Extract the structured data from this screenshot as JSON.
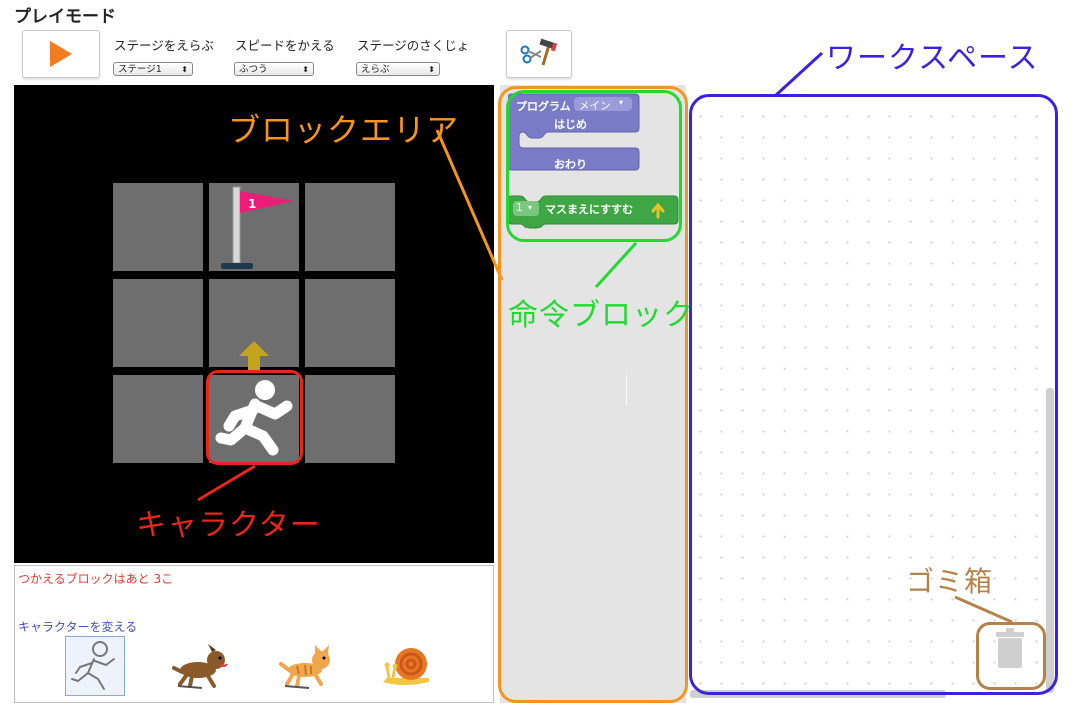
{
  "page_title": "プレイモード",
  "controls": {
    "stage_label": "ステージをえらぶ",
    "stage_value": "ステージ1",
    "speed_label": "スピードをかえる",
    "speed_value": "ふつう",
    "delete_label": "ステージのさくじょ",
    "delete_value": "えらぶ"
  },
  "blocks": {
    "program_label": "プログラム",
    "program_dropdown": "メイン",
    "start_label": "はじめ",
    "end_label": "おわり",
    "move_count": "1",
    "move_label": "マスまえにすすむ"
  },
  "info": {
    "blocks_left": "つかえるブロックはあと 3こ",
    "change_character": "キャラクターを変える"
  },
  "annotations": {
    "block_area": "ブロックエリア",
    "command_block": "命令ブロック",
    "workspace": "ワークスペース",
    "character": "キャラクター",
    "trash": "ゴミ箱"
  },
  "flag_number": "1",
  "icons": [
    "play-icon",
    "tools-icon",
    "flag-icon",
    "up-arrow-icon",
    "runner-icon",
    "dog-icon",
    "cat-icon",
    "snail-icon",
    "trash-icon"
  ],
  "colors": {
    "play": "#f47b20",
    "block_purple": "#7a7bc6",
    "block_green": "#3ea645",
    "ann_orange": "#f7941d",
    "ann_green": "#22d930",
    "ann_blue": "#3a22e0",
    "ann_red": "#e8261c",
    "ann_brown": "#b5824a"
  }
}
